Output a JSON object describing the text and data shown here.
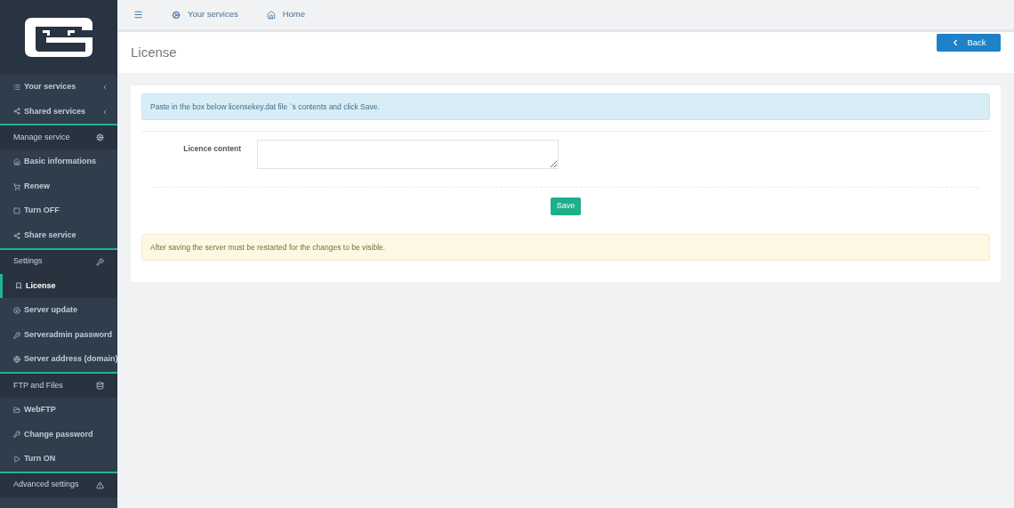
{
  "sidebar": {
    "items": [
      {
        "kind": "item",
        "label": "Your services",
        "expandable": true,
        "selected": false
      },
      {
        "kind": "item",
        "label": "Shared services",
        "expandable": true,
        "selected": false
      },
      {
        "kind": "header",
        "label": "Manage service"
      },
      {
        "kind": "item",
        "label": "Basic informations",
        "expandable": false,
        "selected": false
      },
      {
        "kind": "item",
        "label": "Renew",
        "expandable": false,
        "selected": false
      },
      {
        "kind": "item",
        "label": "Turn OFF",
        "expandable": false,
        "selected": false
      },
      {
        "kind": "item",
        "label": "Share service",
        "expandable": false,
        "selected": false
      },
      {
        "kind": "header",
        "label": "Settings"
      },
      {
        "kind": "item",
        "label": "License",
        "expandable": false,
        "selected": true
      },
      {
        "kind": "item",
        "label": "Server update",
        "expandable": false,
        "selected": false
      },
      {
        "kind": "item",
        "label": "Serveradmin password",
        "expandable": false,
        "selected": false
      },
      {
        "kind": "item",
        "label": "Server address (domain)",
        "expandable": false,
        "selected": false
      },
      {
        "kind": "header",
        "label": "FTP and Files"
      },
      {
        "kind": "item",
        "label": "WebFTP",
        "expandable": false,
        "selected": false
      },
      {
        "kind": "item",
        "label": "Change password",
        "expandable": false,
        "selected": false
      },
      {
        "kind": "item",
        "label": "Turn ON",
        "expandable": false,
        "selected": false
      },
      {
        "kind": "header",
        "label": "Advanced settings"
      }
    ]
  },
  "topbar": {
    "links": [
      "Your services",
      "Home"
    ]
  },
  "page": {
    "title": "License",
    "back_button": "Back"
  },
  "form": {
    "info": "Paste in the box below licensekey.dat file `s contents and click Save.",
    "field_label": "Licence content",
    "save_button": "Save",
    "warning": "After saving the server must be restarted for the changes to be visible."
  }
}
